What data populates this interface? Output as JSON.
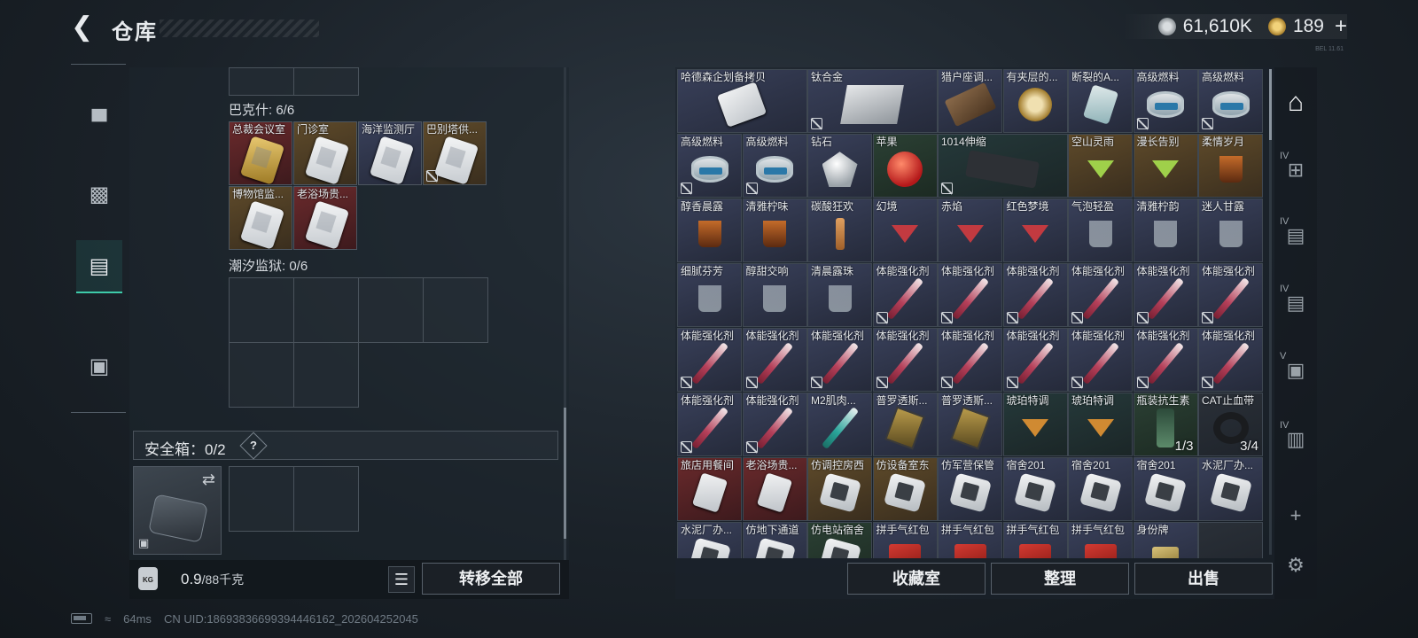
{
  "header": {
    "title": "仓库",
    "silver_value": "61,610K",
    "gold_value": "189",
    "plus": "+",
    "version": "BEL 11.61"
  },
  "left": {
    "bakeshi_title": "巴克什: 6/6",
    "bakeshi_items": [
      {
        "label": "总裁会议室",
        "bg": "red",
        "card": "gold"
      },
      {
        "label": "门诊室",
        "bg": "gold",
        "card": "white"
      },
      {
        "label": "海洋监测厅",
        "bg": "blue",
        "card": "white"
      },
      {
        "label": "巴别塔供...",
        "bg": "gold",
        "card": "white",
        "nolink": true
      },
      {
        "label": "博物馆监...",
        "bg": "gold",
        "card": "white"
      },
      {
        "label": "老浴场贵...",
        "bg": "red",
        "card": "white"
      }
    ],
    "prison_title": "潮汐监狱: 0/6",
    "safebox_title": "安全箱：0/2",
    "safebox_help": "?",
    "weight_value": "0.9",
    "weight_cap": "/88千克",
    "bag_text": "KG",
    "transfer_all": "转移全部"
  },
  "grid_items": [
    {
      "label": "哈德森企划备拷贝",
      "bg": "blue",
      "icon": "card-wide",
      "span": 2
    },
    {
      "label": "钛合金",
      "bg": "blue",
      "icon": "metal",
      "span": 2,
      "nolink": true
    },
    {
      "label": "猎户座调...",
      "bg": "blue",
      "icon": "tape"
    },
    {
      "label": "有夹层的...",
      "bg": "blue",
      "icon": "compass"
    },
    {
      "label": "断裂的A...",
      "bg": "blue",
      "icon": "gcard"
    },
    {
      "label": "高级燃料",
      "bg": "blue",
      "icon": "can",
      "nolink": true
    },
    {
      "label": "高级燃料",
      "bg": "blue",
      "icon": "can",
      "nolink": true
    },
    {
      "label": "高级燃料",
      "bg": "blue",
      "icon": "can",
      "nolink": true
    },
    {
      "label": "高级燃料",
      "bg": "blue",
      "icon": "can",
      "nolink": true
    },
    {
      "label": "钻石",
      "bg": "blue",
      "icon": "gem"
    },
    {
      "label": "苹果",
      "bg": "green",
      "icon": "apple"
    },
    {
      "label": "1014伸缩",
      "bg": "teal",
      "icon": "stock",
      "span": 2,
      "nolink": true
    },
    {
      "label": "空山灵雨",
      "bg": "gold",
      "icon": "cocktail-green"
    },
    {
      "label": "漫长告别",
      "bg": "gold",
      "icon": "cocktail-green"
    },
    {
      "label": "柔情岁月",
      "bg": "gold",
      "icon": "tea"
    },
    {
      "label": "醇香晨露",
      "bg": "blue",
      "icon": "tea"
    },
    {
      "label": "清雅柠味",
      "bg": "blue",
      "icon": "tea"
    },
    {
      "label": "碳酸狂欢",
      "bg": "blue",
      "icon": "flute"
    },
    {
      "label": "幻境",
      "bg": "blue",
      "icon": "cocktail-red"
    },
    {
      "label": "赤焰",
      "bg": "blue",
      "icon": "cocktail-red"
    },
    {
      "label": "红色梦境",
      "bg": "blue",
      "icon": "cocktail-red"
    },
    {
      "label": "气泡轻盈",
      "bg": "blue",
      "icon": "glass"
    },
    {
      "label": "清雅柠韵",
      "bg": "blue",
      "icon": "glass"
    },
    {
      "label": "迷人甘露",
      "bg": "blue",
      "icon": "glass"
    },
    {
      "label": "细腻芬芳",
      "bg": "blue",
      "icon": "glass"
    },
    {
      "label": "醇甜交响",
      "bg": "blue",
      "icon": "glass"
    },
    {
      "label": "清晨露珠",
      "bg": "blue",
      "icon": "glass"
    },
    {
      "label": "体能强化剂",
      "bg": "blue",
      "icon": "syringe",
      "nolink": true
    },
    {
      "label": "体能强化剂",
      "bg": "blue",
      "icon": "syringe",
      "nolink": true
    },
    {
      "label": "体能强化剂",
      "bg": "blue",
      "icon": "syringe",
      "nolink": true
    },
    {
      "label": "体能强化剂",
      "bg": "blue",
      "icon": "syringe",
      "nolink": true
    },
    {
      "label": "体能强化剂",
      "bg": "blue",
      "icon": "syringe",
      "nolink": true
    },
    {
      "label": "体能强化剂",
      "bg": "blue",
      "icon": "syringe",
      "nolink": true
    },
    {
      "label": "体能强化剂",
      "bg": "blue",
      "icon": "syringe",
      "nolink": true
    },
    {
      "label": "体能强化剂",
      "bg": "blue",
      "icon": "syringe",
      "nolink": true
    },
    {
      "label": "体能强化剂",
      "bg": "blue",
      "icon": "syringe",
      "nolink": true
    },
    {
      "label": "体能强化剂",
      "bg": "blue",
      "icon": "syringe",
      "nolink": true
    },
    {
      "label": "体能强化剂",
      "bg": "blue",
      "icon": "syringe",
      "nolink": true
    },
    {
      "label": "体能强化剂",
      "bg": "blue",
      "icon": "syringe",
      "nolink": true
    },
    {
      "label": "体能强化剂",
      "bg": "blue",
      "icon": "syringe",
      "nolink": true
    },
    {
      "label": "体能强化剂",
      "bg": "blue",
      "icon": "syringe",
      "nolink": true
    },
    {
      "label": "体能强化剂",
      "bg": "blue",
      "icon": "syringe",
      "nolink": true
    },
    {
      "label": "体能强化剂",
      "bg": "blue",
      "icon": "syringe",
      "nolink": true
    },
    {
      "label": "体能强化剂",
      "bg": "blue",
      "icon": "syringe",
      "nolink": true
    },
    {
      "label": "M2肌肉...",
      "bg": "blue",
      "icon": "syringe-teal"
    },
    {
      "label": "普罗透斯...",
      "bg": "blue",
      "icon": "chip"
    },
    {
      "label": "普罗透斯...",
      "bg": "blue",
      "icon": "chip"
    },
    {
      "label": "琥珀特调",
      "bg": "teal",
      "icon": "cocktail-amber"
    },
    {
      "label": "琥珀特调",
      "bg": "teal",
      "icon": "cocktail-amber"
    },
    {
      "label": "瓶装抗生素",
      "bg": "green",
      "icon": "bottle",
      "count": "1/3"
    },
    {
      "label": "CAT止血带",
      "bg": "dark",
      "icon": "tourniquet",
      "count": "3/4"
    },
    {
      "label": "旅店用餐间",
      "bg": "red",
      "icon": "card"
    },
    {
      "label": "老浴场贵...",
      "bg": "red",
      "icon": "card"
    },
    {
      "label": "仿调控房西",
      "bg": "gold",
      "icon": "bag"
    },
    {
      "label": "仿设备室东",
      "bg": "gold",
      "icon": "bag"
    },
    {
      "label": "仿军营保管",
      "bg": "blue",
      "icon": "bag"
    },
    {
      "label": "宿舍201",
      "bg": "blue",
      "icon": "bag"
    },
    {
      "label": "宿舍201",
      "bg": "blue",
      "icon": "bag"
    },
    {
      "label": "宿舍201",
      "bg": "blue",
      "icon": "bag"
    },
    {
      "label": "水泥厂办...",
      "bg": "blue",
      "icon": "bag"
    },
    {
      "label": "水泥厂办...",
      "bg": "blue",
      "icon": "bag"
    },
    {
      "label": "仿地下通道",
      "bg": "blue",
      "icon": "bag"
    },
    {
      "label": "仿电站宿舍",
      "bg": "green",
      "icon": "bag"
    },
    {
      "label": "拼手气红包",
      "bg": "blue",
      "icon": "envelope"
    },
    {
      "label": "拼手气红包",
      "bg": "blue",
      "icon": "envelope"
    },
    {
      "label": "拼手气红包",
      "bg": "blue",
      "icon": "envelope"
    },
    {
      "label": "拼手气红包",
      "bg": "blue",
      "icon": "envelope"
    },
    {
      "label": "身份牌",
      "bg": "blue",
      "icon": "tag"
    },
    {
      "label": "",
      "bg": "dark",
      "icon": "none"
    }
  ],
  "right_footer": {
    "collection": "收藏室",
    "sort": "整理",
    "sell": "出售"
  },
  "side_rail": [
    {
      "name": "vault-tab",
      "lv": "",
      "glyph": "⌂"
    },
    {
      "name": "level-iv-add-tab",
      "lv": "IV",
      "glyph": "⊞"
    },
    {
      "name": "level-iv-tab-1",
      "lv": "IV",
      "glyph": "▤"
    },
    {
      "name": "level-iv-tab-2",
      "lv": "IV",
      "glyph": "▤"
    },
    {
      "name": "level-v-tab",
      "lv": "V",
      "glyph": "▣"
    },
    {
      "name": "level-iv-tab-3",
      "lv": "IV",
      "glyph": "▥"
    },
    {
      "name": "add-tab",
      "lv": "",
      "glyph": "+"
    },
    {
      "name": "settings",
      "lv": "",
      "glyph": "⚙"
    }
  ],
  "status": {
    "ping": "64ms",
    "uid": "CN UID:18693836699394446162_202604252045"
  },
  "colors": {
    "accent_teal": "#3ecba9",
    "bg_red": "#6a2a2c",
    "bg_gold": "#5e4a2a",
    "bg_blue": "#39405a"
  }
}
